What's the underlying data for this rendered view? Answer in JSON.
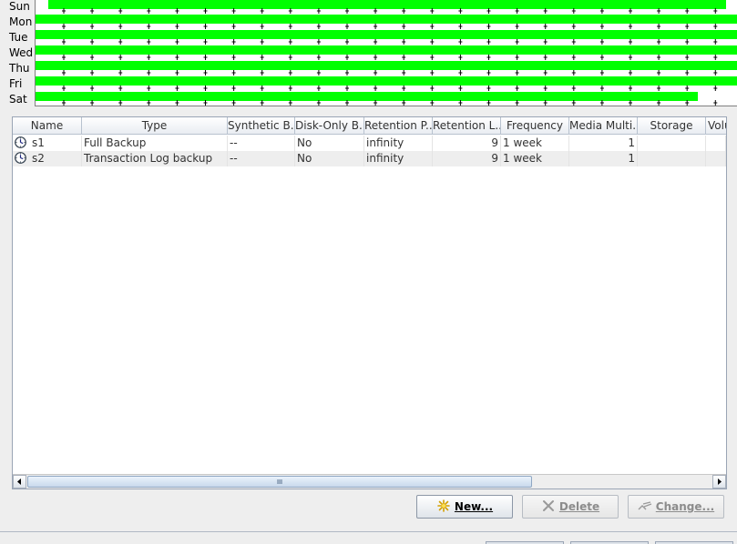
{
  "schedule": {
    "days": [
      "Sun",
      "Mon",
      "Tue",
      "Wed",
      "Thu",
      "Fri",
      "Sat"
    ],
    "bar_color": "#00ff00"
  },
  "table": {
    "columns": [
      "Name",
      "Type",
      "Synthetic B...",
      "Disk-Only B...",
      "Retention P...",
      "Retention L...",
      "Frequency",
      "Media Multi...",
      "Storage",
      "Volu"
    ],
    "rows": [
      {
        "name": "s1",
        "type": "Full Backup",
        "synthetic": "--",
        "disk_only": "No",
        "retention_period": "infinity",
        "retention_level": "9",
        "frequency": "1 week",
        "media_multiplexing": "1",
        "storage": "",
        "volume": ""
      },
      {
        "name": "s2",
        "type": "Transaction Log backup",
        "synthetic": "--",
        "disk_only": "No",
        "retention_period": "infinity",
        "retention_level": "9",
        "frequency": "1 week",
        "media_multiplexing": "1",
        "storage": "",
        "volume": ""
      }
    ],
    "row_icon": "clock-icon"
  },
  "buttons": {
    "new": {
      "label": "New...",
      "icon": "sparkle-icon",
      "enabled": true
    },
    "delete": {
      "label": "Delete",
      "icon": "x-icon",
      "enabled": false
    },
    "change": {
      "label": "Change...",
      "icon": "edit-icon",
      "enabled": false
    }
  }
}
